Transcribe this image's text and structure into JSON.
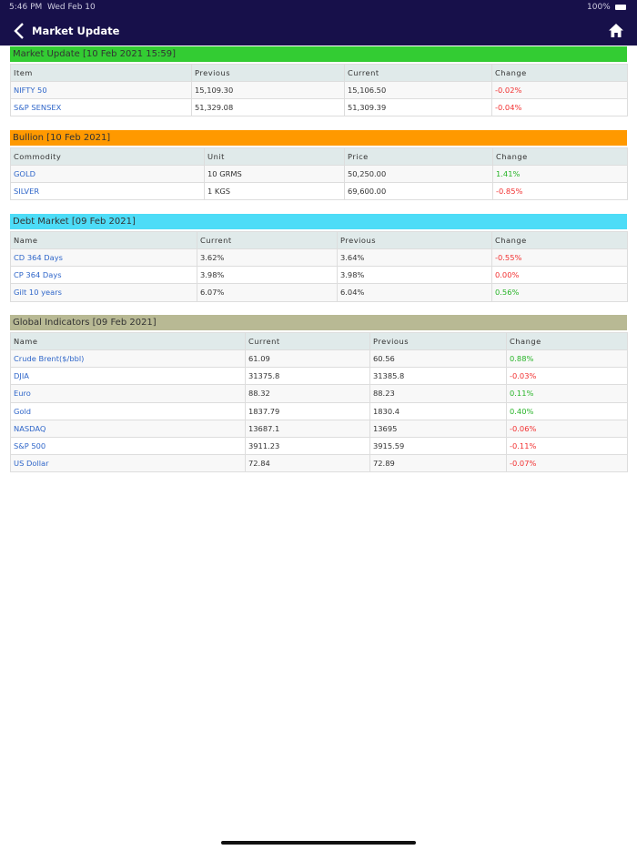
{
  "status": {
    "time": "5:46 PM",
    "date": "Wed Feb 10",
    "battery": "100%"
  },
  "nav": {
    "title": "Market Update",
    "back_icon": "chevron-left-icon",
    "home_icon": "home-icon"
  },
  "colors": {
    "nav": "#17104a",
    "up": "#28b428",
    "down": "#f23030",
    "link": "#2f66c9"
  },
  "sections": [
    {
      "title": "Market Update [10 Feb 2021 15:59]",
      "color": "#33cc33",
      "cols": [
        "Item",
        "Previous",
        "Current",
        "Change"
      ],
      "widths": [
        199,
        168,
        162,
        149
      ],
      "rows": [
        [
          "NIFTY 50",
          "15,109.30",
          "15,106.50",
          "-0.02%"
        ],
        [
          "S&P SENSEX",
          "51,329.08",
          "51,309.39",
          "-0.04%"
        ]
      ]
    },
    {
      "title": "Bullion [10 Feb 2021]",
      "color": "#ff9900",
      "cols": [
        "Commodity",
        "Unit",
        "Price",
        "Change"
      ],
      "widths": [
        213,
        154,
        163,
        148
      ],
      "rows": [
        [
          "GOLD",
          "10 GRMS",
          "50,250.00",
          "1.41%"
        ],
        [
          "SILVER",
          "1 KGS",
          "69,600.00",
          "-0.85%"
        ]
      ]
    },
    {
      "title": "Debt Market [09 Feb 2021]",
      "color": "#4ddcf7",
      "cols": [
        "Name",
        "Current",
        "Previous",
        "Change"
      ],
      "widths": [
        205,
        154,
        170,
        149
      ],
      "rows": [
        [
          "CD 364 Days",
          "3.62%",
          "3.64%",
          "-0.55%"
        ],
        [
          "CP 364 Days",
          "3.98%",
          "3.98%",
          "0.00%"
        ],
        [
          "Gilt 10 years",
          "6.07%",
          "6.04%",
          "0.56%"
        ]
      ]
    },
    {
      "title": "Global Indicators [09 Feb 2021]",
      "color": "#b8b994",
      "cols": [
        "Name",
        "Current",
        "Previous",
        "Change"
      ],
      "widths": [
        258,
        137,
        150,
        133
      ],
      "rows": [
        [
          "Crude Brent($/bbl)",
          "61.09",
          "60.56",
          "0.88%"
        ],
        [
          "DJIA",
          "31375.8",
          "31385.8",
          "-0.03%"
        ],
        [
          "Euro",
          "88.32",
          "88.23",
          "0.11%"
        ],
        [
          "Gold",
          "1837.79",
          "1830.4",
          "0.40%"
        ],
        [
          "NASDAQ",
          "13687.1",
          "13695",
          "-0.06%"
        ],
        [
          "S&P 500",
          "3911.23",
          "3915.59",
          "-0.11%"
        ],
        [
          "US Dollar",
          "72.84",
          "72.89",
          "-0.07%"
        ]
      ]
    }
  ]
}
